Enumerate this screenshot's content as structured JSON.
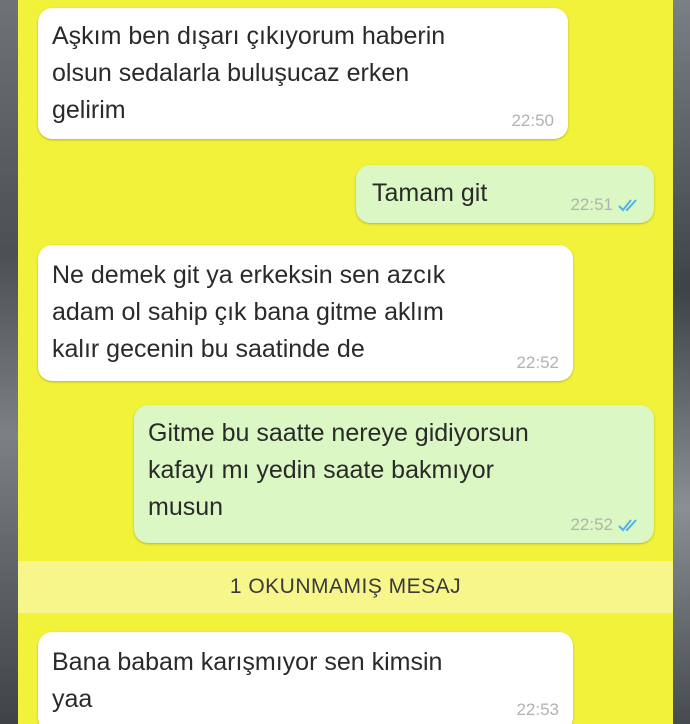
{
  "colors": {
    "chat_background": "#f2f23a",
    "incoming_bubble": "#ffffff",
    "outgoing_bubble": "#dbf7c4",
    "read_ticks": "#4fb3e8",
    "unread_banner": "#f7f68a"
  },
  "messages": [
    {
      "direction": "incoming",
      "lines": [
        "Aşkım ben dışarı çıkıyorum haberin",
        "olsun sedalarla buluşucaz erken",
        "gelirim"
      ],
      "time": "22:50"
    },
    {
      "direction": "outgoing",
      "lines": [
        "Tamam git"
      ],
      "time": "22:51",
      "status_icon": "double-check-read-icon"
    },
    {
      "direction": "incoming",
      "lines": [
        "Ne demek git ya erkeksin sen azcık",
        "adam ol sahip çık bana gitme aklım",
        "kalır gecenin bu saatinde de"
      ],
      "time": "22:52"
    },
    {
      "direction": "outgoing",
      "lines": [
        "Gitme bu saatte nereye gidiyorsun",
        "kafayı mı yedin saate bakmıyor",
        "musun"
      ],
      "time": "22:52",
      "status_icon": "double-check-read-icon"
    },
    {
      "direction": "incoming",
      "lines": [
        "Bana babam karışmıyor sen kimsin",
        "yaa"
      ],
      "time": "22:53"
    }
  ],
  "unread_banner": {
    "label": "1 OKUNMAMIŞ MESAJ"
  }
}
